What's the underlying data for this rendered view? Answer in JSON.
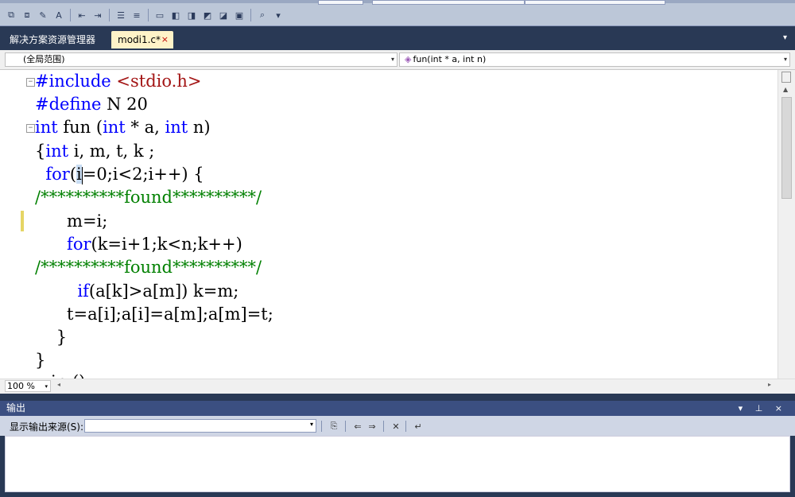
{
  "toolbar": {
    "buttons": [
      {
        "name": "format-selection-icon",
        "glyph": "⧉"
      },
      {
        "name": "format-document-icon",
        "glyph": "⧈"
      },
      {
        "name": "word-wrap-icon",
        "glyph": "✎"
      },
      {
        "name": "font-icon",
        "glyph": "A"
      },
      {
        "name": "decrease-indent-icon",
        "glyph": "⇤"
      },
      {
        "name": "increase-indent-icon",
        "glyph": "⇥"
      },
      {
        "name": "comment-icon",
        "glyph": "☰"
      },
      {
        "name": "uncomment-icon",
        "glyph": "≡"
      },
      {
        "name": "toggle-bookmark-icon",
        "glyph": "▭"
      },
      {
        "name": "prev-bookmark-icon",
        "glyph": "◧"
      },
      {
        "name": "next-bookmark-icon",
        "glyph": "◨"
      },
      {
        "name": "prev-bookmark-folder-icon",
        "glyph": "◩"
      },
      {
        "name": "next-bookmark-folder-icon",
        "glyph": "◪"
      },
      {
        "name": "clear-bookmarks-icon",
        "glyph": "▣"
      },
      {
        "name": "find-icon",
        "glyph": "⌕"
      },
      {
        "name": "toolbar-options-icon",
        "glyph": "▾"
      }
    ]
  },
  "tabs": {
    "solution_explorer": "解决方案资源管理器",
    "active_file": "modi1.c*",
    "close_glyph": "×",
    "dropdown_glyph": "▾"
  },
  "navbar": {
    "scope": "(全局范围)",
    "member": "fun(int * a, int n)",
    "fn_icon": "◈",
    "arrow": "▾"
  },
  "code": {
    "line1_kw": "#include",
    "line1_str": " <stdio.h>",
    "line2_kw": "#define",
    "line2_rest": " N 20",
    "line3_kw1": "int",
    "line3_mid": " fun (",
    "line3_kw2": "int",
    "line3_mid2": " * a, ",
    "line3_kw3": "int",
    "line3_end": " n)",
    "line4_brace": "{",
    "line4_kw": "int",
    "line4_rest": " i, m, t, k ;",
    "line5_kw": "  for",
    "line5_open": "(",
    "line5_sel": "i",
    "line5_rest": "=0;i<2;i++) {",
    "line6_comment": "/**********found**********/",
    "line7": "      m=i;",
    "line8_kw": "      for",
    "line8_rest": "(k=i+1;k<n;k++)",
    "line9_comment": "/**********found**********/",
    "line10_kw": "        if",
    "line10_rest": "(a[k]>a[m]) k=m;",
    "line11": "      t=a[i];a[i]=a[m];a[m]=t;",
    "line12": "    }",
    "line13": "}",
    "line14": "   in ()"
  },
  "outline": {
    "collapse": "−"
  },
  "statusbar": {
    "zoom": "100 %",
    "arrow": "▾",
    "left_arrow": "◂",
    "right_arrow": "▸"
  },
  "scrollbar": {
    "up_arrow": "▲"
  },
  "output": {
    "title": "输出",
    "controls": "▾ ⊥ ×",
    "source_label": "显示输出来源(S):",
    "source_value": "",
    "arrow": "▾",
    "buttons": [
      {
        "name": "go-to-line-icon",
        "glyph": "⎘"
      },
      {
        "name": "prev-message-icon",
        "glyph": "⇐"
      },
      {
        "name": "next-message-icon",
        "glyph": "⇒"
      },
      {
        "name": "clear-all-icon",
        "glyph": "✕"
      },
      {
        "name": "toggle-word-wrap-icon",
        "glyph": "↵"
      }
    ]
  }
}
